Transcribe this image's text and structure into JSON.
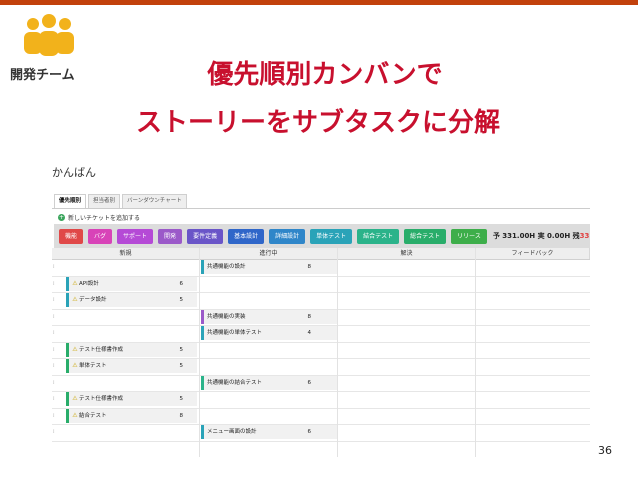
{
  "slide": {
    "team_label": "開発チーム",
    "title_line1": "優先順別カンバンで",
    "title_line2": "ストーリーをサブタスクに分解",
    "page_number": "36"
  },
  "app": {
    "title": "かんばん",
    "tabs": [
      "優先順別",
      "担当者別",
      "バーンダウンチャート"
    ],
    "add_ticket": "新しいチケットを追加する",
    "filters": [
      {
        "label": "機能",
        "color": "#e04848"
      },
      {
        "label": "バグ",
        "color": "#d843b8"
      },
      {
        "label": "サポート",
        "color": "#b54ad6"
      },
      {
        "label": "開発",
        "color": "#9b59c9"
      },
      {
        "label": "要件定義",
        "color": "#6a55c8"
      },
      {
        "label": "基本設計",
        "color": "#2f66c9"
      },
      {
        "label": "詳細設計",
        "color": "#2f86c9"
      },
      {
        "label": "単体テスト",
        "color": "#2aa3b8"
      },
      {
        "label": "結合テスト",
        "color": "#2bb38a"
      },
      {
        "label": "総合テスト",
        "color": "#29ad6a"
      },
      {
        "label": "リリース",
        "color": "#3dae4a"
      }
    ],
    "summary": {
      "planned": "予 331.00H",
      "actual": "実 0.00H",
      "remaining_label": "残",
      "remaining_value": "33"
    },
    "columns": [
      "新規",
      "進行中",
      "解決",
      "フィードバック"
    ],
    "rows": [
      {
        "col": 1,
        "name": "共通機能の設計",
        "points": "8",
        "color": "#2aa3b8"
      },
      {
        "col": 0,
        "name": "API設計",
        "points": "6",
        "color": "#2aa3b8"
      },
      {
        "col": 0,
        "name": "データ設計",
        "points": "5",
        "color": "#2aa3b8"
      },
      {
        "col": 1,
        "name": "共通機能の実装",
        "points": "8",
        "color": "#9b59c9"
      },
      {
        "col": 1,
        "name": "共通機能の単体テスト",
        "points": "4",
        "color": "#2aa3b8"
      },
      {
        "col": 0,
        "name": "テスト仕様書作成",
        "points": "5",
        "color": "#29ad6a"
      },
      {
        "col": 0,
        "name": "単体テスト",
        "points": "5",
        "color": "#29ad6a"
      },
      {
        "col": 1,
        "name": "共通機能の結合テスト",
        "points": "6",
        "color": "#2bb38a"
      },
      {
        "col": 0,
        "name": "テスト仕様書作成",
        "points": "5",
        "color": "#29ad6a"
      },
      {
        "col": 0,
        "name": "結合テスト",
        "points": "8",
        "color": "#29ad6a"
      },
      {
        "col": 1,
        "name": "メニュー画面の設計",
        "points": "6",
        "color": "#2aa3b8"
      }
    ]
  }
}
